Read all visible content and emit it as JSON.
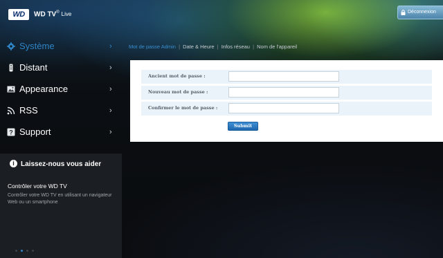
{
  "header": {
    "logo": "WD",
    "brand": "WD TV",
    "trademark": "®",
    "edition": "Live",
    "logout_label": "Déconnexion"
  },
  "sidebar": {
    "items": [
      {
        "label": "Système",
        "icon": "gear-icon",
        "active": true
      },
      {
        "label": "Distant",
        "icon": "remote-icon",
        "active": false
      },
      {
        "label": "Appearance",
        "icon": "image-icon",
        "active": false
      },
      {
        "label": "RSS",
        "icon": "rss-icon",
        "active": false
      },
      {
        "label": "Support",
        "icon": "question-icon",
        "active": false
      }
    ],
    "chevron": "›"
  },
  "help": {
    "icon_glyph": "i",
    "heading": "Laissez-nous vous aider",
    "title": "Contrôler votre WD TV",
    "description": "Contrôler votre WD TV en utilisant un navigateur Web ou un smartphone",
    "dots_total": 4,
    "dots_active": 2
  },
  "tabs": [
    {
      "label": "Mot de passe Admin",
      "active": true
    },
    {
      "label": "Date & Heure",
      "active": false
    },
    {
      "label": "Infos réseau",
      "active": false
    },
    {
      "label": "Nom de l'appareil",
      "active": false
    }
  ],
  "tab_separator": "|",
  "form": {
    "fields": [
      {
        "label": "Ancient mot de passe :",
        "value": ""
      },
      {
        "label": "Nouveau mot de passe :",
        "value": ""
      },
      {
        "label": "Confirmer le mot de passe :",
        "value": ""
      }
    ],
    "submit_label": "Submit"
  },
  "colors": {
    "accent": "#2f84c6",
    "panel_row": "#eaf3fa",
    "submit": "#2a7cc6"
  }
}
